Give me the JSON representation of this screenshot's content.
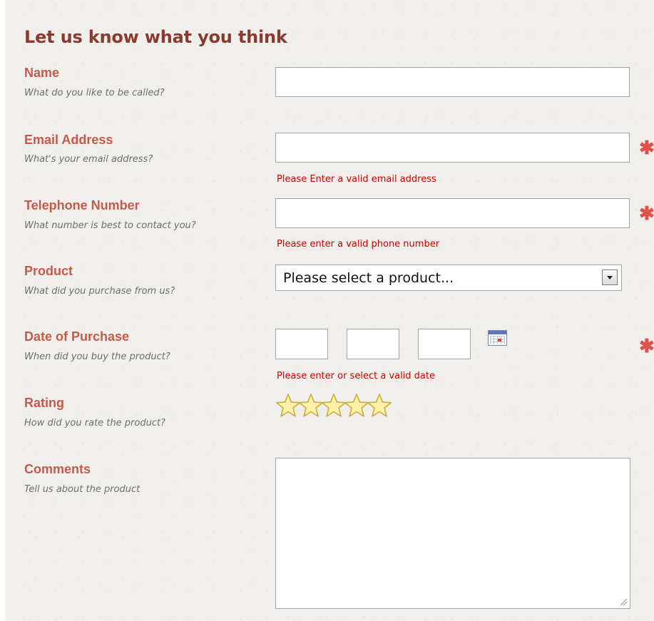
{
  "form": {
    "title": "Let us know what you think"
  },
  "fields": {
    "name": {
      "label": "Name",
      "hint": "What do you like to be called?",
      "value": ""
    },
    "email": {
      "label": "Email Address",
      "hint": "What's your email address?",
      "value": "",
      "error": "Please Enter a valid email address",
      "required": true
    },
    "telephone": {
      "label": "Telephone Number",
      "hint": "What number is best to contact you?",
      "value": "",
      "error": "Please enter a valid phone number",
      "required": true
    },
    "product": {
      "label": "Product",
      "hint": "What did you purchase from us?",
      "selected": "Please select a product..."
    },
    "date": {
      "label": "Date of Purchase",
      "hint": "When did you buy the product?",
      "error": "Please enter or select a valid date",
      "required": true,
      "parts": [
        "",
        "",
        ""
      ]
    },
    "rating": {
      "label": "Rating",
      "hint": "How did you rate the product?",
      "max": 5,
      "value": 0
    },
    "comments": {
      "label": "Comments",
      "hint": "Tell us about the product",
      "value": ""
    }
  },
  "required_marker": "✱",
  "icons": {
    "required": "asterisk-icon",
    "calendar": "calendar-icon",
    "rating": "star-icon",
    "dropdown": "chevron-down-icon",
    "resize": "resize-grip-icon"
  },
  "colors": {
    "title": "#8a3a2e",
    "label": "#c45a4a",
    "hint": "#6e6e6e",
    "error": "#cc0000",
    "required": "#e0514a",
    "star_fill": "#fff2a8",
    "star_stroke": "#c9ac3f",
    "background": "#f1efec"
  }
}
